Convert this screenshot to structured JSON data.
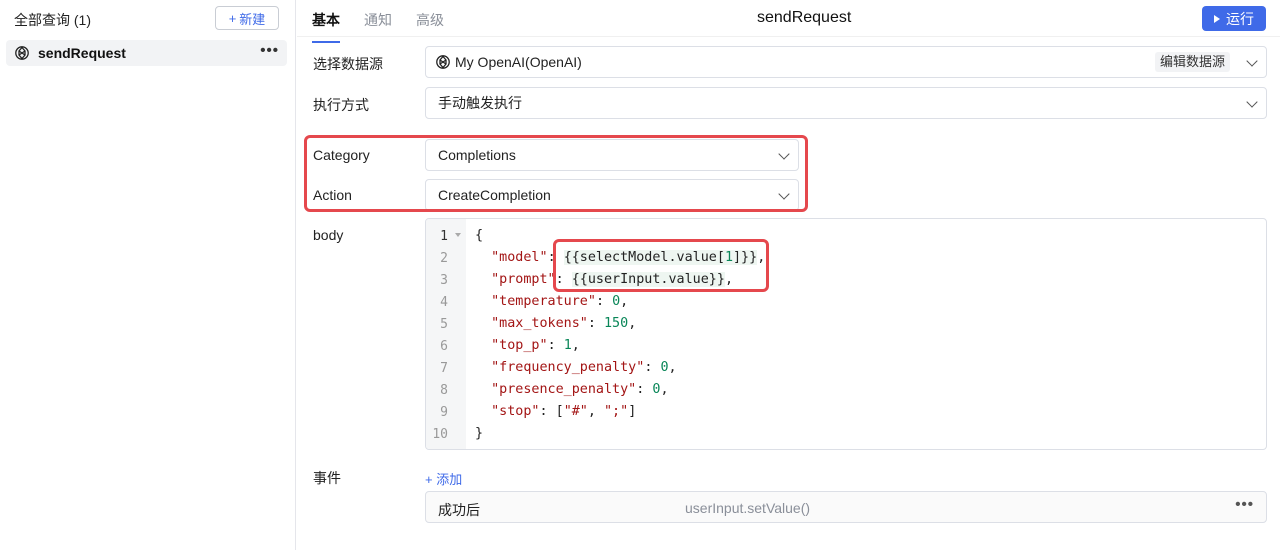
{
  "sidebar": {
    "heading": "全部查询 (1)",
    "new_button": "新建",
    "queries": [
      {
        "label": "sendRequest",
        "icon": "openai-icon"
      }
    ]
  },
  "header": {
    "tabs": [
      "基本",
      "通知",
      "高级"
    ],
    "active_tab": "基本",
    "title": "sendRequest",
    "run_button": "运行"
  },
  "form": {
    "datasource": {
      "label": "选择数据源",
      "value": "My OpenAI(OpenAI)",
      "edit_label": "编辑数据源"
    },
    "trigger": {
      "label": "执行方式",
      "value": "手动触发执行"
    },
    "category": {
      "label": "Category",
      "value": "Completions"
    },
    "action": {
      "label": "Action",
      "value": "CreateCompletion"
    },
    "body": {
      "label": "body"
    }
  },
  "code": {
    "line_numbers": [
      "1",
      "2",
      "3",
      "4",
      "5",
      "6",
      "7",
      "8",
      "9",
      "10"
    ],
    "lines": [
      "{",
      "  \"model\": {{selectModel.value[1]}},",
      "  \"prompt\": {{userInput.value}},",
      "  \"temperature\": 0,",
      "  \"max_tokens\": 150,",
      "  \"top_p\": 1,",
      "  \"frequency_penalty\": 0,",
      "  \"presence_penalty\": 0,",
      "  \"stop\": [\"#\", \";\"]",
      "}"
    ]
  },
  "events": {
    "label": "事件",
    "add_link": "+ 添加",
    "items": [
      {
        "name": "成功后",
        "action": "userInput.setValue()"
      }
    ]
  },
  "colors": {
    "accent": "#3f6ae8",
    "highlight": "#e5484d"
  }
}
